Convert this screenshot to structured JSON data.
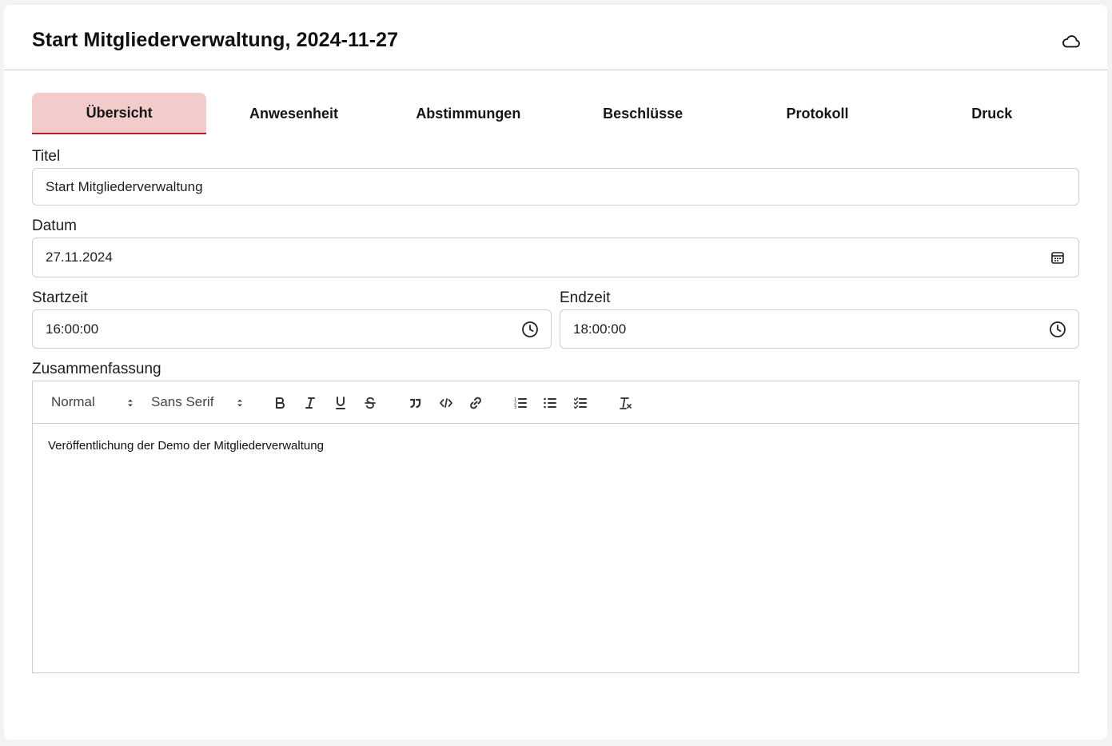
{
  "header": {
    "title": "Start Mitgliederverwaltung, 2024-11-27",
    "cloud_icon": "cloud-icon"
  },
  "tabs": [
    {
      "label": "Übersicht",
      "active": true
    },
    {
      "label": "Anwesenheit",
      "active": false
    },
    {
      "label": "Abstimmungen",
      "active": false
    },
    {
      "label": "Beschlüsse",
      "active": false
    },
    {
      "label": "Protokoll",
      "active": false
    },
    {
      "label": "Druck",
      "active": false
    }
  ],
  "form": {
    "title_label": "Titel",
    "title_value": "Start Mitgliederverwaltung",
    "date_label": "Datum",
    "date_value": "27.11.2024",
    "start_label": "Startzeit",
    "start_value": "16:00:00",
    "end_label": "Endzeit",
    "end_value": "18:00:00",
    "summary_label": "Zusammenfassung"
  },
  "editor": {
    "header_select": "Normal",
    "font_select": "Sans Serif",
    "content": "Veröffentlichung der Demo der Mitgliederverwaltung"
  },
  "colors": {
    "active_tab_bg": "#f2cbcb",
    "active_tab_border": "#b11f2a"
  }
}
